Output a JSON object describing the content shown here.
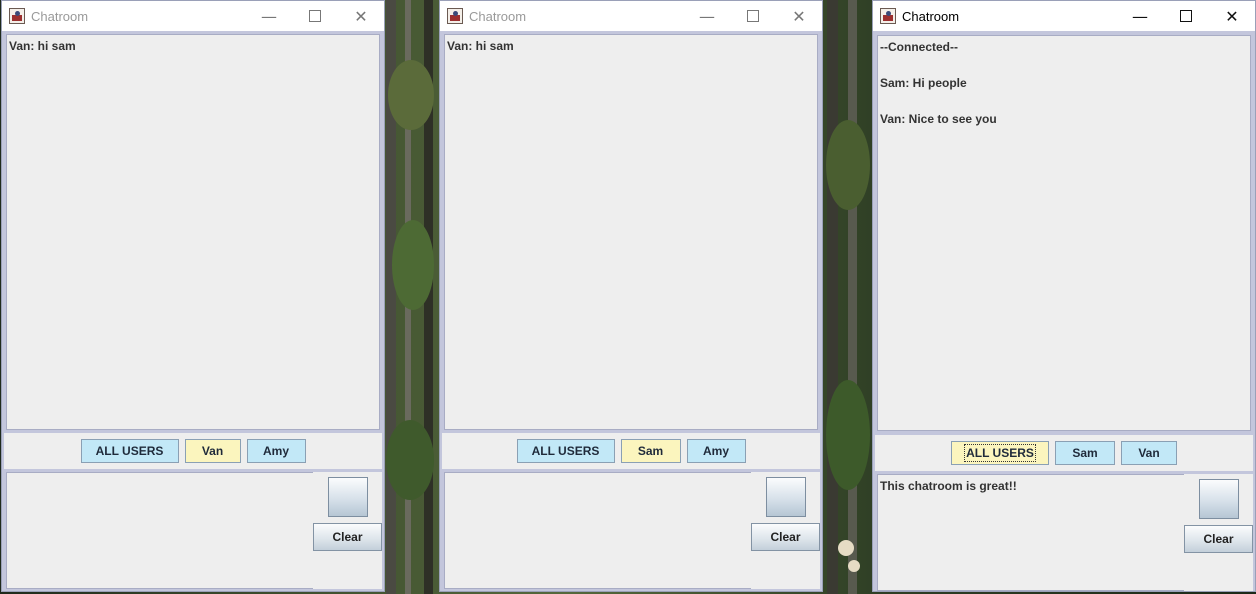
{
  "windows": [
    {
      "title": "Chatroom",
      "controls": {
        "minimize": "—",
        "close": "✕"
      },
      "messages": [
        "Van: hi sam"
      ],
      "users": [
        "ALL USERS",
        "Van",
        "Amy"
      ],
      "selected_user": "Van",
      "input_text": "",
      "clear_label": "Clear"
    },
    {
      "title": "Chatroom",
      "controls": {
        "minimize": "—",
        "close": "✕"
      },
      "messages": [
        "Van: hi sam"
      ],
      "users": [
        "ALL USERS",
        "Sam",
        "Amy"
      ],
      "selected_user": "Sam",
      "input_text": "",
      "clear_label": "Clear"
    },
    {
      "title": "Chatroom",
      "controls": {
        "minimize": "—",
        "close": "✕"
      },
      "messages": [
        "--Connected--",
        "",
        "Sam: Hi people",
        "",
        "Van: Nice to see you"
      ],
      "users": [
        "ALL USERS",
        "Sam",
        "Van"
      ],
      "selected_user": "ALL USERS",
      "input_text": "This chatroom is great!!",
      "clear_label": "Clear"
    }
  ],
  "colors": {
    "user_button": "#c2e8f7",
    "selected_user_button": "#fbf5be",
    "panel": "#eeeeee",
    "frame": "#c3c6dc"
  }
}
